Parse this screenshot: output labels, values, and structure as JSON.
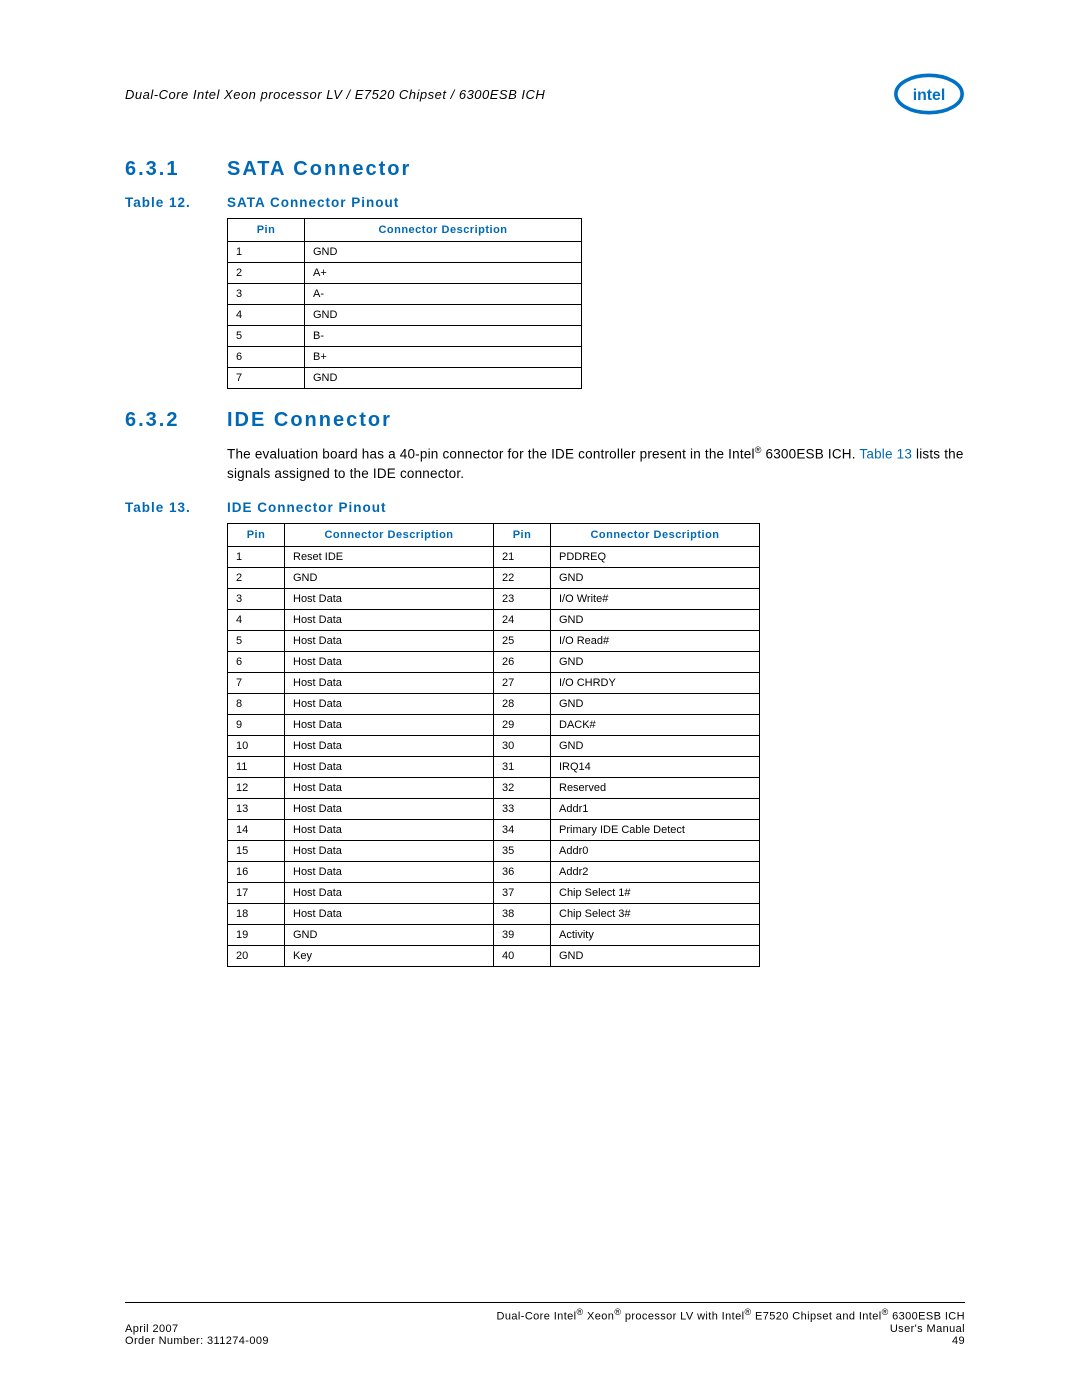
{
  "header": {
    "title": "Dual-Core Intel Xeon processor LV / E7520 Chipset / 6300ESB ICH"
  },
  "section1": {
    "num": "6.3.1",
    "title": "SATA Connector"
  },
  "table12": {
    "caption_label": "Table 12.",
    "caption_title": "SATA Connector Pinout",
    "head_pin": "Pin",
    "head_desc": "Connector Description",
    "rows": [
      {
        "pin": "1",
        "desc": "GND"
      },
      {
        "pin": "2",
        "desc": "A+"
      },
      {
        "pin": "3",
        "desc": "A-"
      },
      {
        "pin": "4",
        "desc": "GND"
      },
      {
        "pin": "5",
        "desc": "B-"
      },
      {
        "pin": "6",
        "desc": "B+"
      },
      {
        "pin": "7",
        "desc": "GND"
      }
    ]
  },
  "section2": {
    "num": "6.3.2",
    "title": "IDE Connector",
    "para_before": "The evaluation board has a 40-pin connector for the IDE controller present in the Intel",
    "para_after1": " 6300ESB ICH. ",
    "para_link": "Table 13",
    "para_after2": " lists the signals assigned to the IDE connector."
  },
  "table13": {
    "caption_label": "Table 13.",
    "caption_title": "IDE Connector Pinout",
    "head_pin": "Pin",
    "head_desc": "Connector Description",
    "rows": [
      {
        "p1": "1",
        "d1": "Reset IDE",
        "p2": "21",
        "d2": "PDDREQ"
      },
      {
        "p1": "2",
        "d1": "GND",
        "p2": "22",
        "d2": "GND"
      },
      {
        "p1": "3",
        "d1": "Host Data",
        "p2": "23",
        "d2": "I/O Write#"
      },
      {
        "p1": "4",
        "d1": "Host Data",
        "p2": "24",
        "d2": "GND"
      },
      {
        "p1": "5",
        "d1": "Host Data",
        "p2": "25",
        "d2": "I/O Read#"
      },
      {
        "p1": "6",
        "d1": "Host Data",
        "p2": "26",
        "d2": "GND"
      },
      {
        "p1": "7",
        "d1": "Host Data",
        "p2": "27",
        "d2": "I/O CHRDY"
      },
      {
        "p1": "8",
        "d1": "Host Data",
        "p2": "28",
        "d2": "GND"
      },
      {
        "p1": "9",
        "d1": "Host Data",
        "p2": "29",
        "d2": "DACK#"
      },
      {
        "p1": "10",
        "d1": "Host Data",
        "p2": "30",
        "d2": "GND"
      },
      {
        "p1": "11",
        "d1": "Host Data",
        "p2": "31",
        "d2": "IRQ14"
      },
      {
        "p1": "12",
        "d1": "Host Data",
        "p2": "32",
        "d2": "Reserved"
      },
      {
        "p1": "13",
        "d1": "Host Data",
        "p2": "33",
        "d2": "Addr1"
      },
      {
        "p1": "14",
        "d1": "Host Data",
        "p2": "34",
        "d2": "Primary IDE Cable Detect"
      },
      {
        "p1": "15",
        "d1": "Host Data",
        "p2": "35",
        "d2": "Addr0"
      },
      {
        "p1": "16",
        "d1": "Host Data",
        "p2": "36",
        "d2": "Addr2"
      },
      {
        "p1": "17",
        "d1": "Host Data",
        "p2": "37",
        "d2": "Chip Select 1#"
      },
      {
        "p1": "18",
        "d1": "Host Data",
        "p2": "38",
        "d2": "Chip Select 3#"
      },
      {
        "p1": "19",
        "d1": "GND",
        "p2": "39",
        "d2": "Activity"
      },
      {
        "p1": "20",
        "d1": "Key",
        "p2": "40",
        "d2": "GND"
      }
    ]
  },
  "footer": {
    "line1_right_a": "Dual-Core Intel",
    "line1_right_b": " Xeon",
    "line1_right_c": " processor LV with Intel",
    "line1_right_d": " E7520 Chipset and Intel",
    "line1_right_e": " 6300ESB ICH",
    "line2_left": "April 2007",
    "line2_right": "User's Manual",
    "line3_left": "Order Number: 311274-009",
    "line3_right": "49",
    "reg": "®"
  }
}
